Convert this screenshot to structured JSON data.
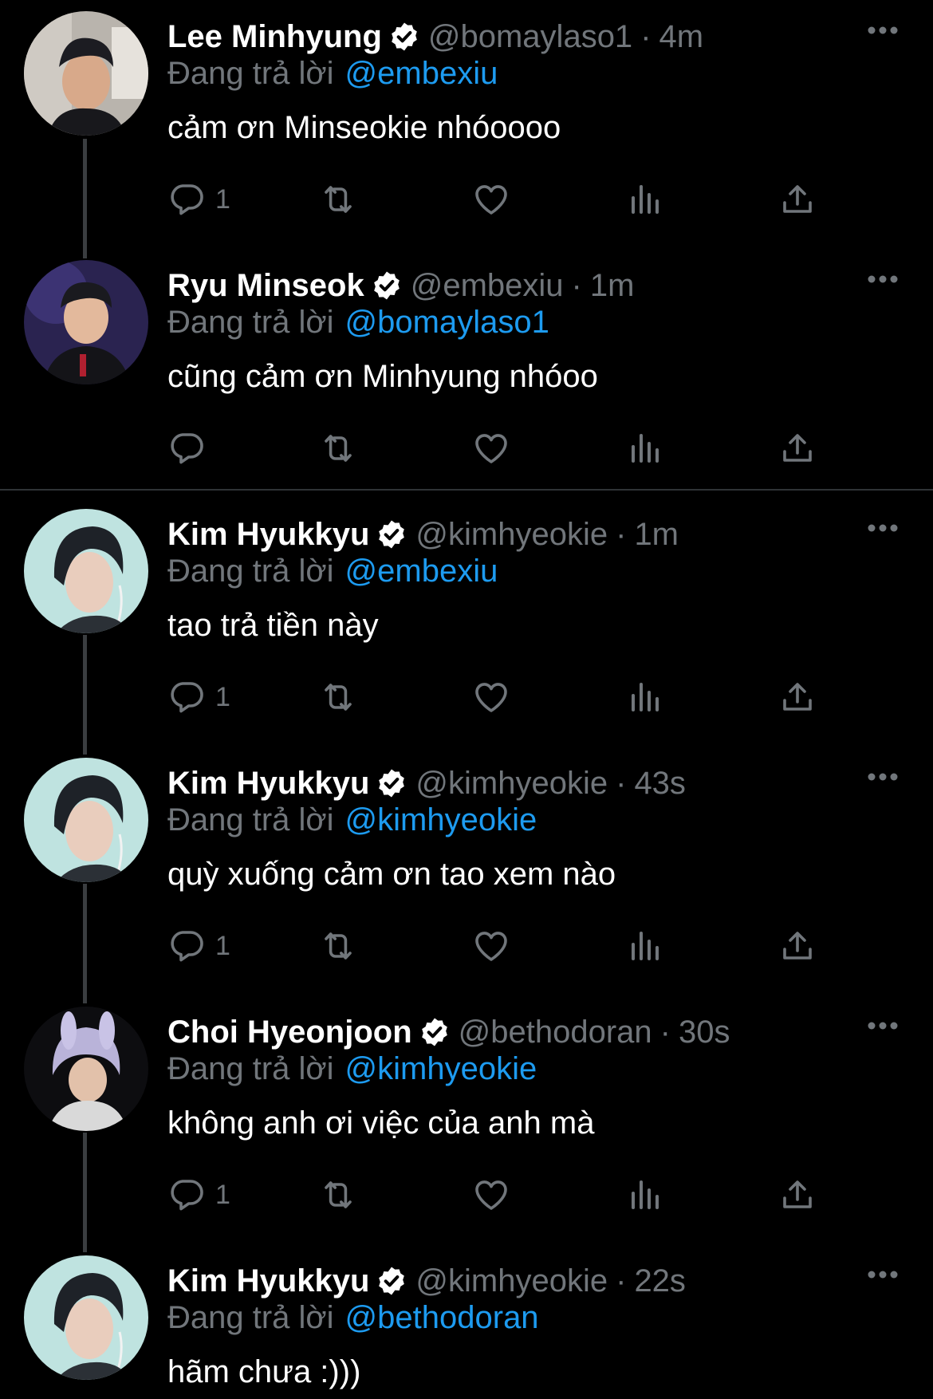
{
  "replying_prefix": "Đang trả lời",
  "colors": {
    "background": "#000000",
    "mention": "#1d9bf0",
    "muted": "#71767b",
    "text": "#ffffff"
  },
  "tweets": [
    {
      "name": "Lee Minhyung",
      "handle": "@bomaylaso1",
      "sep": "·",
      "time": "4m",
      "reply_to": "@embexiu",
      "text": "cảm ơn Minseokie nhóoooo",
      "reply_count": "1"
    },
    {
      "name": "Ryu Minseok",
      "handle": "@embexiu",
      "sep": "·",
      "time": "1m",
      "reply_to": "@bomaylaso1",
      "text": "cũng cảm ơn Minhyung nhóoo",
      "reply_count": ""
    },
    {
      "name": "Kim Hyukkyu",
      "handle": "@kimhyeokie",
      "sep": "·",
      "time": "1m",
      "reply_to": "@embexiu",
      "text": "tao trả tiền này",
      "reply_count": "1"
    },
    {
      "name": "Kim Hyukkyu",
      "handle": "@kimhyeokie",
      "sep": "·",
      "time": "43s",
      "reply_to": "@kimhyeokie",
      "text": "quỳ xuống cảm ơn tao xem nào",
      "reply_count": "1"
    },
    {
      "name": "Choi Hyeonjoon",
      "handle": "@bethodoran",
      "sep": "·",
      "time": "30s",
      "reply_to": "@kimhyeokie",
      "text": "không anh ơi việc của anh mà",
      "reply_count": "1"
    },
    {
      "name": "Kim Hyukkyu",
      "handle": "@kimhyeokie",
      "sep": "·",
      "time": "22s",
      "reply_to": "@bethodoran",
      "text": "hãm chưa :)))",
      "reply_count": ""
    }
  ],
  "icons": {
    "verified": "verified-badge-icon",
    "more": "more-options-icon",
    "reply": "reply-icon",
    "retweet": "retweet-icon",
    "like": "like-icon",
    "views": "views-icon",
    "share": "share-icon"
  }
}
